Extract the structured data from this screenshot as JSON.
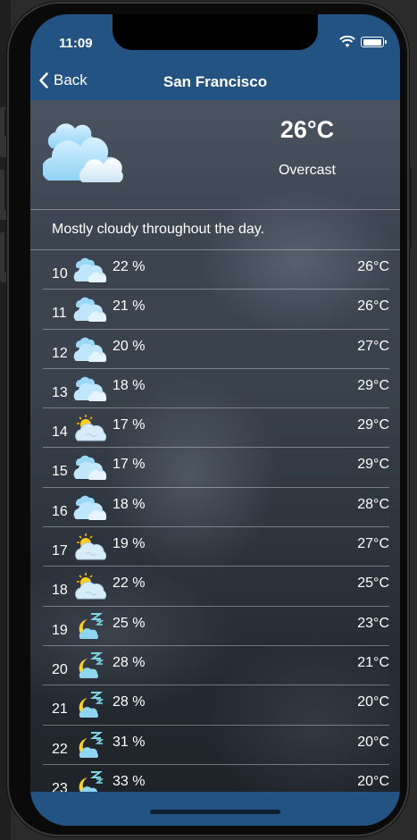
{
  "status": {
    "time": "11:09"
  },
  "nav": {
    "back_label": "Back",
    "title": "San Francisco"
  },
  "current": {
    "temp": "26°C",
    "condition": "Overcast",
    "icon": "cloud-icon"
  },
  "summary": "Mostly cloudy throughout the day.",
  "hours": [
    {
      "hour": "10",
      "pct": "22 %",
      "temp": "26°C",
      "icon": "cloud-icon"
    },
    {
      "hour": "11",
      "pct": "21 %",
      "temp": "26°C",
      "icon": "cloud-icon"
    },
    {
      "hour": "12",
      "pct": "20 %",
      "temp": "27°C",
      "icon": "cloud-icon"
    },
    {
      "hour": "13",
      "pct": "18 %",
      "temp": "29°C",
      "icon": "cloud-icon"
    },
    {
      "hour": "14",
      "pct": "17 %",
      "temp": "29°C",
      "icon": "sun-cloud-icon"
    },
    {
      "hour": "15",
      "pct": "17 %",
      "temp": "29°C",
      "icon": "cloud-icon"
    },
    {
      "hour": "16",
      "pct": "18 %",
      "temp": "28°C",
      "icon": "cloud-icon"
    },
    {
      "hour": "17",
      "pct": "19 %",
      "temp": "27°C",
      "icon": "sun-cloud-icon"
    },
    {
      "hour": "18",
      "pct": "22 %",
      "temp": "25°C",
      "icon": "sun-cloud-icon"
    },
    {
      "hour": "19",
      "pct": "25 %",
      "temp": "23°C",
      "icon": "moon-cloud-icon"
    },
    {
      "hour": "20",
      "pct": "28 %",
      "temp": "21°C",
      "icon": "moon-cloud-icon"
    },
    {
      "hour": "21",
      "pct": "28 %",
      "temp": "20°C",
      "icon": "moon-cloud-icon"
    },
    {
      "hour": "22",
      "pct": "31 %",
      "temp": "20°C",
      "icon": "moon-cloud-icon"
    },
    {
      "hour": "23",
      "pct": "33 %",
      "temp": "20°C",
      "icon": "moon-cloud-icon"
    }
  ],
  "colors": {
    "bar": "#235382",
    "text": "#ffffff"
  }
}
